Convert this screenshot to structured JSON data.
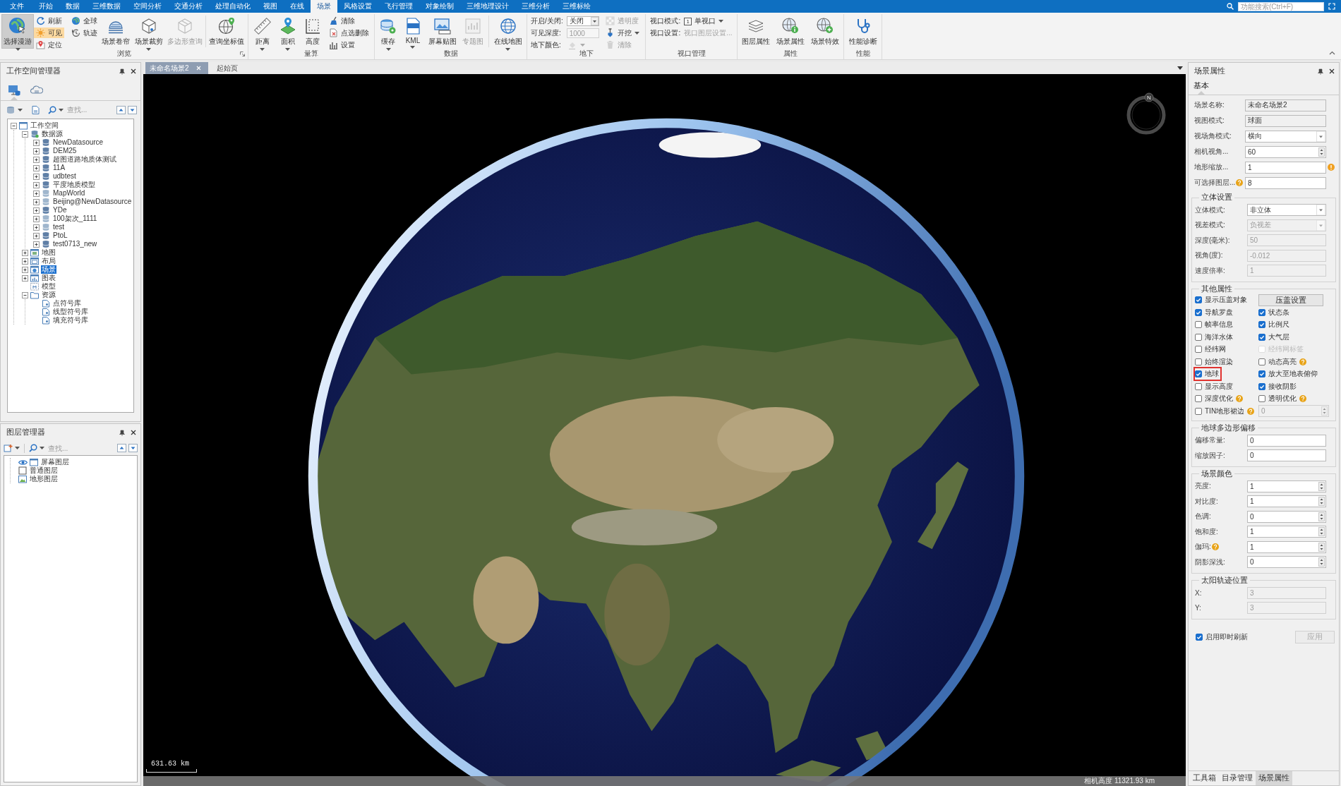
{
  "menu_bar": {
    "tabs": [
      {
        "label": "文件",
        "selected": false
      },
      {
        "label": "开始",
        "selected": false
      },
      {
        "label": "数据",
        "selected": false
      },
      {
        "label": "三维数据",
        "selected": false
      },
      {
        "label": "空间分析",
        "selected": false
      },
      {
        "label": "交通分析",
        "selected": false
      },
      {
        "label": "处理自动化",
        "selected": false
      },
      {
        "label": "视图",
        "selected": false
      },
      {
        "label": "在线",
        "selected": false
      },
      {
        "label": "场景",
        "selected": true
      },
      {
        "label": "风格设置",
        "selected": false
      },
      {
        "label": "飞行管理",
        "selected": false
      },
      {
        "label": "对象绘制",
        "selected": false
      },
      {
        "label": "三维地理设计",
        "selected": false
      },
      {
        "label": "三维分析",
        "selected": false
      },
      {
        "label": "三维标绘",
        "selected": false
      }
    ],
    "search": {
      "placeholder": "功能搜索(Ctrl+F)"
    }
  },
  "ribbon": {
    "groups": [
      {
        "label": "浏览",
        "dialog_launcher": true,
        "items": [
          {
            "kind": "large",
            "label": "选择漫游",
            "selected": true,
            "disabled": false,
            "dropdown": true
          },
          {
            "kind": "stack",
            "buttons": [
              {
                "label": "刷新",
                "selected": false,
                "disabled": false,
                "dropdown": false
              },
              {
                "label": "可见",
                "selected": true,
                "disabled": false,
                "dropdown": false
              },
              {
                "label": "定位",
                "selected": false,
                "disabled": false,
                "dropdown": false
              }
            ]
          },
          {
            "kind": "stack",
            "buttons": [
              {
                "label": "全球",
                "selected": false,
                "disabled": false,
                "dropdown": false
              },
              {
                "label": "轨迹",
                "selected": false,
                "disabled": false,
                "dropdown": false
              }
            ]
          },
          {
            "kind": "large",
            "label": "场景卷帘",
            "selected": false,
            "disabled": false,
            "dropdown": false
          },
          {
            "kind": "large",
            "label": "场景裁剪",
            "selected": false,
            "disabled": false,
            "dropdown": true
          },
          {
            "kind": "large",
            "label": "多边形查询",
            "selected": false,
            "disabled": true,
            "dropdown": false
          },
          {
            "kind": "separator"
          },
          {
            "kind": "large",
            "label": "查询坐标值",
            "selected": false,
            "disabled": false,
            "dropdown": false
          }
        ]
      },
      {
        "label": "量算",
        "dialog_launcher": false,
        "items": [
          {
            "kind": "large",
            "label": "距离",
            "selected": false,
            "disabled": false,
            "dropdown": true
          },
          {
            "kind": "large",
            "label": "面积",
            "selected": false,
            "disabled": false,
            "dropdown": true
          },
          {
            "kind": "large",
            "label": "高度",
            "selected": false,
            "disabled": false,
            "dropdown": false
          },
          {
            "kind": "stack",
            "buttons": [
              {
                "label": "清除",
                "selected": false,
                "disabled": false,
                "dropdown": false
              },
              {
                "label": "点选删除",
                "selected": false,
                "disabled": false,
                "dropdown": false
              },
              {
                "label": "设置",
                "selected": false,
                "disabled": false,
                "dropdown": false
              }
            ]
          }
        ]
      },
      {
        "label": "数据",
        "dialog_launcher": false,
        "items": [
          {
            "kind": "large",
            "label": "缓存",
            "selected": false,
            "disabled": false,
            "dropdown": true
          },
          {
            "kind": "large",
            "label": "KML",
            "selected": false,
            "disabled": false,
            "dropdown": true
          },
          {
            "kind": "large",
            "label": "屏幕贴图",
            "selected": false,
            "disabled": false,
            "dropdown": false
          },
          {
            "kind": "large",
            "label": "专题图",
            "selected": false,
            "disabled": true,
            "dropdown": false
          },
          {
            "kind": "separator"
          },
          {
            "kind": "large",
            "label": "在线地图",
            "selected": false,
            "disabled": false,
            "dropdown": true
          }
        ]
      },
      {
        "label": "地下",
        "dialog_launcher": false,
        "items": [
          {
            "kind": "fields",
            "rows": [
              {
                "label": "开启/关闭:",
                "kind": "dropdown",
                "value": "关闭",
                "disabled": false
              },
              {
                "label": "可见深度:",
                "kind": "text",
                "value": "1000",
                "disabled": true
              },
              {
                "label": "地下颜色:",
                "kind": "color",
                "disabled": true
              }
            ]
          },
          {
            "kind": "stack",
            "buttons": [
              {
                "label": "透明度",
                "selected": false,
                "disabled": true,
                "dropdown": false
              },
              {
                "label": "开挖",
                "selected": false,
                "disabled": false,
                "dropdown": true
              },
              {
                "label": "清除",
                "selected": false,
                "disabled": true,
                "dropdown": false
              }
            ]
          }
        ]
      },
      {
        "label": "视口管理",
        "dialog_launcher": false,
        "items": [
          {
            "kind": "fields",
            "rows": [
              {
                "label": "视口模式:",
                "kind": "menu",
                "badge": "1",
                "value": "单视口",
                "disabled": false
              },
              {
                "label": "视口设置:",
                "kind": "link",
                "value": "视口图层设置...",
                "disabled": true
              }
            ]
          }
        ]
      },
      {
        "label": "属性",
        "dialog_launcher": false,
        "items": [
          {
            "kind": "large",
            "label": "图层属性",
            "selected": false,
            "disabled": false,
            "dropdown": false
          },
          {
            "kind": "large",
            "label": "场景属性",
            "selected": false,
            "disabled": false,
            "dropdown": false
          },
          {
            "kind": "large",
            "label": "场景特效",
            "selected": false,
            "disabled": false,
            "dropdown": false
          }
        ]
      },
      {
        "label": "性能",
        "dialog_launcher": false,
        "items": [
          {
            "kind": "large",
            "label": "性能诊断",
            "selected": false,
            "disabled": false,
            "dropdown": false
          }
        ]
      }
    ]
  },
  "workspace_manager": {
    "title": "工作空间管理器",
    "view_tabs": [
      {
        "selected": true
      },
      {
        "selected": false
      }
    ],
    "search": {
      "placeholder": "查找..."
    },
    "tree": [
      {
        "label": "工作空间",
        "kind": "workspace",
        "expanded": true,
        "selected": false,
        "children": [
          {
            "label": "数据源",
            "kind": "datasources",
            "expanded": true,
            "selected": false,
            "children": [
              {
                "label": "NewDatasource",
                "kind": "datasource",
                "expanded": false,
                "selected": false
              },
              {
                "label": "DEM25",
                "kind": "datasource",
                "expanded": false,
                "selected": false
              },
              {
                "label": "超图道路地质体测试",
                "kind": "datasource",
                "expanded": false,
                "selected": false
              },
              {
                "label": "11A",
                "kind": "datasource",
                "expanded": false,
                "selected": false
              },
              {
                "label": "udbtest",
                "kind": "datasource",
                "expanded": false,
                "selected": false
              },
              {
                "label": "平度地质模型",
                "kind": "datasource",
                "expanded": false,
                "selected": false
              },
              {
                "label": "MapWorld",
                "kind": "remote-datasource",
                "expanded": false,
                "selected": false
              },
              {
                "label": "Beijing@NewDatasource",
                "kind": "remote-datasource",
                "expanded": false,
                "selected": false
              },
              {
                "label": "YDe",
                "kind": "datasource",
                "expanded": false,
                "selected": false
              },
              {
                "label": "100架次_1111",
                "kind": "remote-datasource",
                "expanded": false,
                "selected": false
              },
              {
                "label": "test",
                "kind": "remote-datasource",
                "expanded": false,
                "selected": false
              },
              {
                "label": "PtoL",
                "kind": "datasource",
                "expanded": false,
                "selected": false
              },
              {
                "label": "test0713_new",
                "kind": "datasource",
                "expanded": false,
                "selected": false
              }
            ]
          },
          {
            "label": "地图",
            "kind": "map",
            "expanded": false,
            "selected": false
          },
          {
            "label": "布局",
            "kind": "layout",
            "expanded": false,
            "selected": false
          },
          {
            "label": "场景",
            "kind": "scene",
            "expanded": false,
            "selected": true
          },
          {
            "label": "图表",
            "kind": "chart",
            "expanded": false,
            "selected": false
          },
          {
            "label": "模型",
            "kind": "model",
            "selected": false
          },
          {
            "label": "资源",
            "kind": "resources",
            "expanded": true,
            "selected": false,
            "children": [
              {
                "label": "点符号库",
                "kind": "symbol-library",
                "selected": false
              },
              {
                "label": "线型符号库",
                "kind": "symbol-library",
                "selected": false
              },
              {
                "label": "填充符号库",
                "kind": "symbol-library",
                "selected": false
              }
            ]
          }
        ]
      }
    ]
  },
  "layer_manager": {
    "title": "图层管理器",
    "search": {
      "placeholder": "查找..."
    },
    "layers": [
      {
        "label": "屏幕图层",
        "kind": "screen",
        "visible": true,
        "selected": false
      },
      {
        "label": "普通图层",
        "kind": "normal",
        "visible": false,
        "selected": false
      },
      {
        "label": "地形图层",
        "kind": "terrain",
        "visible": false,
        "selected": false
      }
    ]
  },
  "map": {
    "tabs": [
      {
        "label": "未命名场景2",
        "selected": true,
        "closable": true
      },
      {
        "label": "起始页",
        "selected": false,
        "closable": false
      }
    ],
    "compass": {
      "label": "N"
    },
    "scale_bar": {
      "label": "631.63 km"
    },
    "status_bar": {
      "text": "相机高度 11321.93 km"
    }
  },
  "scene_properties": {
    "title": "场景属性",
    "tabs": [
      {
        "label": "基本",
        "selected": true
      }
    ],
    "fields": [
      {
        "label": "场景名称:",
        "value": "未命名场景2",
        "kind": "readonly",
        "disabled": false,
        "help": false,
        "warning": false
      },
      {
        "label": "视图模式:",
        "value": "球面",
        "kind": "readonly",
        "disabled": false,
        "help": false,
        "warning": false
      },
      {
        "label": "视场角模式:",
        "value": "横向",
        "kind": "dropdown",
        "disabled": false,
        "help": false,
        "warning": false
      },
      {
        "label": "相机视角...",
        "value": "60",
        "kind": "spinner",
        "disabled": false,
        "help": false,
        "warning": false
      },
      {
        "label": "地形缩放...",
        "value": "1",
        "kind": "text",
        "disabled": false,
        "help": false,
        "warning": true
      },
      {
        "label": "可选择图层...",
        "value": "8",
        "kind": "text",
        "disabled": false,
        "help": true,
        "warning": false
      }
    ],
    "sections": [
      {
        "title": "立体设置",
        "kind": "fields",
        "fields": [
          {
            "label": "立体模式:",
            "value": "非立体",
            "kind": "dropdown",
            "disabled": false,
            "help": false,
            "warning": false
          },
          {
            "label": "视差模式:",
            "value": "负视差",
            "kind": "dropdown",
            "disabled": true,
            "help": false,
            "warning": false
          },
          {
            "label": "深度(毫米):",
            "value": "50",
            "kind": "text",
            "disabled": true,
            "help": false,
            "warning": false
          },
          {
            "label": "视角(度):",
            "value": "-0.012",
            "kind": "text",
            "disabled": true,
            "help": false,
            "warning": false
          },
          {
            "label": "速度倍率:",
            "value": "1",
            "kind": "text",
            "disabled": true,
            "help": false,
            "warning": false
          }
        ]
      },
      {
        "title": "其他属性",
        "kind": "options",
        "items": [
          {
            "kind": "checkbox",
            "label": "显示压盖对象",
            "checked": true,
            "disabled": false,
            "help": false,
            "highlighted": false
          },
          {
            "kind": "button",
            "label": "压盖设置"
          },
          {
            "kind": "checkbox",
            "label": "导航罗盘",
            "checked": true,
            "disabled": false,
            "help": false,
            "highlighted": false
          },
          {
            "kind": "checkbox",
            "label": "状态条",
            "checked": true,
            "disabled": false,
            "help": false,
            "highlighted": false
          },
          {
            "kind": "checkbox",
            "label": "帧率信息",
            "checked": false,
            "disabled": false,
            "help": false,
            "highlighted": false
          },
          {
            "kind": "checkbox",
            "label": "比例尺",
            "checked": true,
            "disabled": false,
            "help": false,
            "highlighted": false
          },
          {
            "kind": "checkbox",
            "label": "海洋水体",
            "checked": false,
            "disabled": false,
            "help": false,
            "highlighted": false
          },
          {
            "kind": "checkbox",
            "label": "大气层",
            "checked": true,
            "disabled": false,
            "help": false,
            "highlighted": false
          },
          {
            "kind": "checkbox",
            "label": "经纬网",
            "checked": false,
            "disabled": false,
            "help": false,
            "highlighted": false
          },
          {
            "kind": "checkbox",
            "label": "经纬网标签",
            "checked": false,
            "disabled": true,
            "help": false,
            "highlighted": false
          },
          {
            "kind": "checkbox",
            "label": "始终渲染",
            "checked": false,
            "disabled": false,
            "help": false,
            "highlighted": false
          },
          {
            "kind": "checkbox",
            "label": "动态高亮",
            "checked": false,
            "disabled": false,
            "help": true,
            "highlighted": false
          },
          {
            "kind": "checkbox",
            "label": "地球",
            "checked": true,
            "disabled": false,
            "help": false,
            "highlighted": true
          },
          {
            "kind": "checkbox",
            "label": "放大至地表俯仰",
            "checked": true,
            "disabled": false,
            "help": false,
            "highlighted": false
          },
          {
            "kind": "checkbox",
            "label": "显示高度",
            "checked": false,
            "disabled": false,
            "help": false,
            "highlighted": false
          },
          {
            "kind": "checkbox",
            "label": "接收阴影",
            "checked": true,
            "disabled": false,
            "help": false,
            "highlighted": false
          },
          {
            "kind": "checkbox",
            "label": "深度优化",
            "checked": false,
            "disabled": false,
            "help": true,
            "highlighted": false
          },
          {
            "kind": "checkbox",
            "label": "透明优化",
            "checked": false,
            "disabled": false,
            "help": true,
            "highlighted": false
          },
          {
            "kind": "checkbox",
            "label": "TIN地形裙边",
            "checked": false,
            "disabled": false,
            "help": true,
            "highlighted": false
          },
          {
            "kind": "spinner",
            "value": "0",
            "disabled": true
          }
        ]
      },
      {
        "title": "地球多边形偏移",
        "kind": "fields",
        "fields": [
          {
            "label": "偏移常量:",
            "value": "0",
            "kind": "text",
            "disabled": false,
            "help": false,
            "warning": false
          },
          {
            "label": "缩放因子:",
            "value": "0",
            "kind": "text",
            "disabled": false,
            "help": false,
            "warning": false
          }
        ]
      },
      {
        "title": "场景颜色",
        "kind": "fields",
        "fields": [
          {
            "label": "亮度:",
            "value": "1",
            "kind": "spinner",
            "disabled": false,
            "help": false,
            "warning": false
          },
          {
            "label": "对比度:",
            "value": "1",
            "kind": "spinner",
            "disabled": false,
            "help": false,
            "warning": false
          },
          {
            "label": "色调:",
            "value": "0",
            "kind": "spinner",
            "disabled": false,
            "help": false,
            "warning": false
          },
          {
            "label": "饱和度:",
            "value": "1",
            "kind": "spinner",
            "disabled": false,
            "help": false,
            "warning": false
          },
          {
            "label": "伽玛:",
            "value": "1",
            "kind": "spinner",
            "disabled": false,
            "help": true,
            "warning": false
          },
          {
            "label": "阴影深浅:",
            "value": "0",
            "kind": "spinner",
            "disabled": false,
            "help": false,
            "warning": false
          }
        ]
      },
      {
        "title": "太阳轨迹位置",
        "kind": "fields",
        "fields": [
          {
            "label": "X:",
            "value": "3",
            "kind": "text",
            "disabled": true,
            "help": false,
            "warning": false
          },
          {
            "label": "Y:",
            "value": "3",
            "kind": "text",
            "disabled": true,
            "help": false,
            "warning": false
          }
        ]
      }
    ],
    "live_refresh": {
      "label": "启用即时刷新",
      "checked": true
    },
    "apply_button": {
      "label": "应用",
      "disabled": true
    },
    "bottom_tabs": [
      {
        "label": "工具箱",
        "selected": false
      },
      {
        "label": "目录管理",
        "selected": false
      },
      {
        "label": "场景属性",
        "selected": true
      }
    ]
  }
}
